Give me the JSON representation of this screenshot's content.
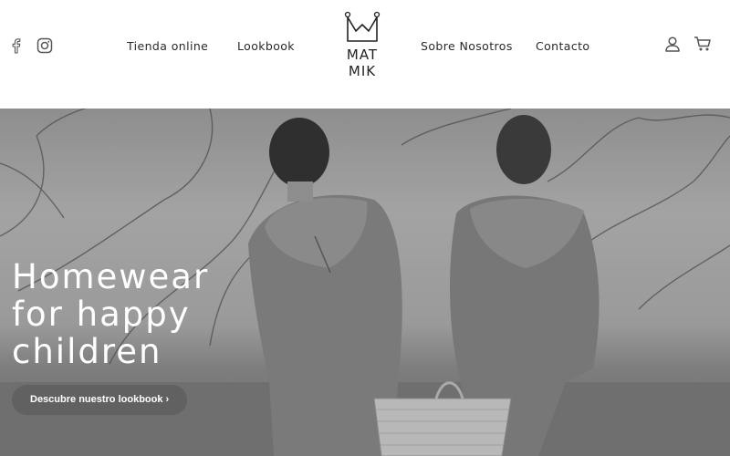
{
  "header": {
    "nav": [
      {
        "label": "Tienda online"
      },
      {
        "label": "Lookbook"
      },
      {
        "label": "Sobre Nosotros"
      },
      {
        "label": "Contacto"
      }
    ],
    "logo": {
      "line1": "MAT",
      "line2": "MIK"
    },
    "icons": {
      "social": [
        "facebook-icon",
        "instagram-icon"
      ],
      "actions": [
        "user-icon",
        "cart-icon"
      ]
    }
  },
  "hero": {
    "headline": [
      "Homewear",
      "for happy",
      "children"
    ],
    "cta_label": "Descubre nuestro lookbook ›"
  },
  "colors": {
    "header_bg": "#ffffff",
    "text": "#222222",
    "hero_text": "#ffffff",
    "cta_bg": "#5f5f5f"
  }
}
